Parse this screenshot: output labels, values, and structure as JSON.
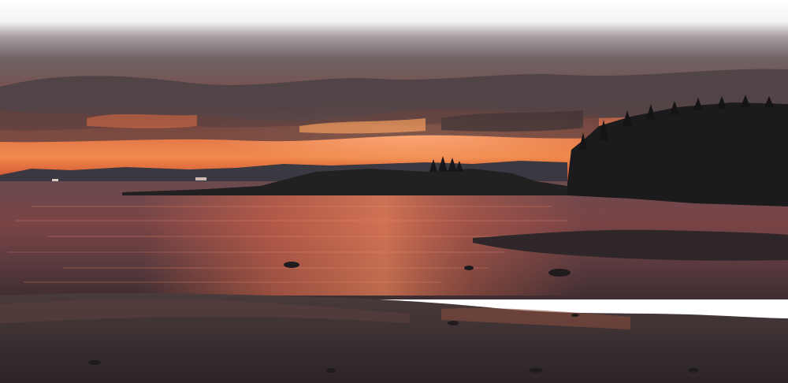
{
  "scene": {
    "description_free": true,
    "palette": {
      "sky_top": "#ffffff",
      "cloud_gray": "#6e6265",
      "cloud_dark": "#4a3e42",
      "sunset_orange": "#f08a4b",
      "sunset_red": "#c9462e",
      "horizon_glow": "#ff9a5a",
      "water_base": "#5a3a3e",
      "water_reflection": "#e26a4a",
      "land_dark": "#1e1c1e",
      "beach": "#3a3233"
    }
  }
}
